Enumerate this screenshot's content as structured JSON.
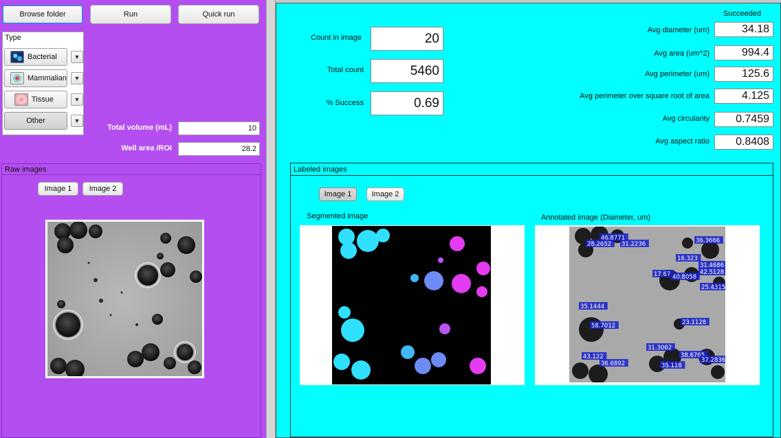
{
  "toolbar": {
    "browse_label": "Browse folder",
    "run_label": "Run",
    "quick_run_label": "Quick run"
  },
  "type_panel": {
    "title": "Type",
    "items": [
      {
        "label": "Bacterial",
        "icon": "bacteria-thumbnail-icon"
      },
      {
        "label": "Mammalian",
        "icon": "mammalian-cell-thumbnail-icon"
      },
      {
        "label": "Tissue",
        "icon": "tissue-thumbnail-icon"
      },
      {
        "label": "Other",
        "icon": ""
      }
    ],
    "arrow_glyph": "▼"
  },
  "inputs": {
    "total_volume_label": "Total volume (mL)",
    "total_volume_value": "10",
    "well_area_label": "Well area /ROI",
    "well_area_value": "28.2"
  },
  "raw_images": {
    "title": "Raw images",
    "tabs": [
      "Image 1",
      "Image 2"
    ]
  },
  "stats": {
    "count_label": "Count in image",
    "count_value": "20",
    "total_label": "Total count",
    "total_value": "5460",
    "success_label": "% Success",
    "success_value": "0.69"
  },
  "status": "Succeeded",
  "averages": [
    {
      "label": "Avg diameter (um)",
      "value": "34.18"
    },
    {
      "label": "Avg area (um^2)",
      "value": "994.4"
    },
    {
      "label": "Avg perimeter (um)",
      "value": "125.6"
    },
    {
      "label": "Avg perimeter over square root of area",
      "value": "4.125"
    },
    {
      "label": "Avg circularity",
      "value": "0.7459"
    },
    {
      "label": "Avg aspect ratio",
      "value": "0.8408"
    }
  ],
  "labeled_images": {
    "title": "Labeled images",
    "tabs": [
      "Image 1",
      "Image 2"
    ],
    "segmented_title": "Segmented image",
    "annotated_title": "Annotated image (Diameter, um)",
    "annotations": [
      "46.8771",
      "28.2652",
      "31.2236",
      "36.3666",
      "16.323",
      "31.4686",
      "42.5128",
      "17.67",
      "40.8058",
      "25.4315",
      "35.1444",
      "58.7012",
      "23.1128",
      "31.3062",
      "43.122",
      "38.6765",
      "37.2836",
      "36.6892",
      "35.118"
    ]
  },
  "colors": {
    "left_bg": "#b44ef0",
    "right_bg": "#00ffff",
    "annotation_bg": "#1a22c8"
  }
}
